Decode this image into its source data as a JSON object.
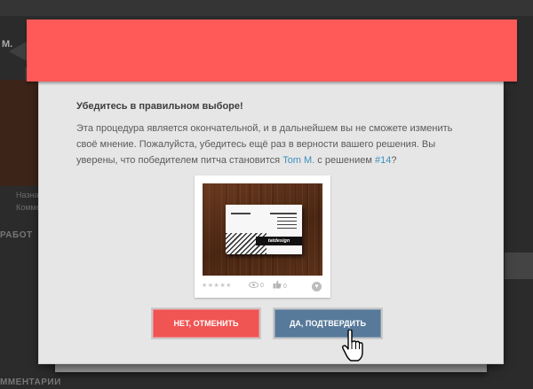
{
  "background": {
    "left_snippet_1": "М.",
    "left_snippet_2": "Назна",
    "left_snippet_3": "Комме",
    "left_heading": "РАБОТ",
    "bottom_heading": "ММЕНТАРИИ"
  },
  "modal": {
    "title": "Убедитесь в правильном выборе!",
    "text_before_user": "Эта процедура является окончательной, и в дальнейшем вы не сможете изменить своё мнение. Пожалуйста, убедитесь ещё раз в верности вашего решения. Вы уверены, что победителем питча становится ",
    "user_link": "Tom M.",
    "text_middle": " с решением ",
    "solution_link": "#14",
    "text_after": "?"
  },
  "card": {
    "brand_text": "tatdesign",
    "stars": "★★★★★",
    "views": "0",
    "likes": "0"
  },
  "buttons": {
    "cancel_label": "НЕТ, ОТМЕНИТЬ",
    "confirm_label": "ДА, ПОДТВЕРДИТЬ"
  },
  "colors": {
    "ribbon": "#ff5a58",
    "cancel": "#f05553",
    "confirm": "#57799a",
    "link": "#3f8fbf"
  },
  "icons": [
    "eye-icon",
    "thumbs-up-icon",
    "heart-icon",
    "hand-pointer-cursor-icon"
  ]
}
